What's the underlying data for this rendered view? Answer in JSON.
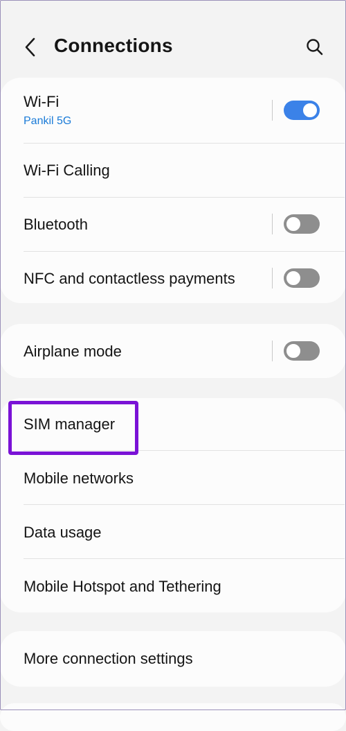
{
  "header": {
    "title": "Connections",
    "back_icon": "chevron-left-icon",
    "search_icon": "search-icon"
  },
  "sections": {
    "wireless": {
      "wifi": {
        "label": "Wi-Fi",
        "network": "Pankil 5G",
        "enabled": true
      },
      "wifi_calling": {
        "label": "Wi-Fi Calling"
      },
      "bluetooth": {
        "label": "Bluetooth",
        "enabled": false
      },
      "nfc": {
        "label": "NFC and contactless payments",
        "enabled": false
      }
    },
    "airplane": {
      "airplane_mode": {
        "label": "Airplane mode",
        "enabled": false
      }
    },
    "mobile": {
      "sim_manager": {
        "label": "SIM manager"
      },
      "mobile_networks": {
        "label": "Mobile networks"
      },
      "data_usage": {
        "label": "Data usage"
      },
      "hotspot": {
        "label": "Mobile Hotspot and Tethering"
      }
    },
    "more": {
      "more_settings": {
        "label": "More connection settings"
      }
    }
  },
  "colors": {
    "accent": "#3b82e8",
    "highlight": "#7a12d6",
    "subtext": "#1a7bd8"
  }
}
